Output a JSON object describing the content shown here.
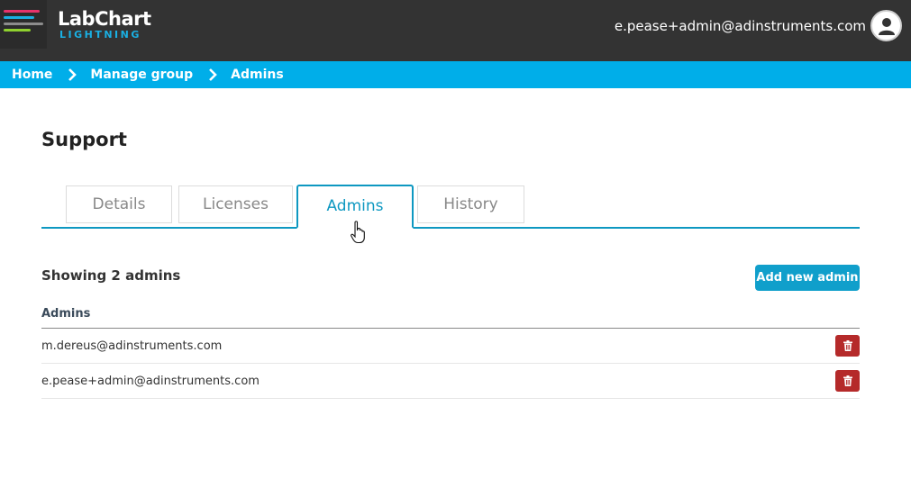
{
  "header": {
    "logo_title": "LabChart",
    "logo_subtitle": "LIGHTNING",
    "user_email": "e.pease+admin@adinstruments.com"
  },
  "breadcrumb": [
    "Home",
    "Manage group",
    "Admins"
  ],
  "page": {
    "title": "Support"
  },
  "tabs": [
    {
      "label": "Details",
      "active": false
    },
    {
      "label": "Licenses",
      "active": false
    },
    {
      "label": "Admins",
      "active": true
    },
    {
      "label": "History",
      "active": false
    }
  ],
  "admins_section": {
    "showing_text": "Showing 2 admins",
    "add_button_label": "Add new admin",
    "column_header": "Admins",
    "rows": [
      {
        "email": "m.dereus@adinstruments.com"
      },
      {
        "email": "e.pease+admin@adinstruments.com"
      }
    ]
  },
  "colors": {
    "header_bg": "#333333",
    "breadcrumb_bg": "#00aee9",
    "accent": "#0e98c1",
    "delete": "#b52a2a"
  }
}
